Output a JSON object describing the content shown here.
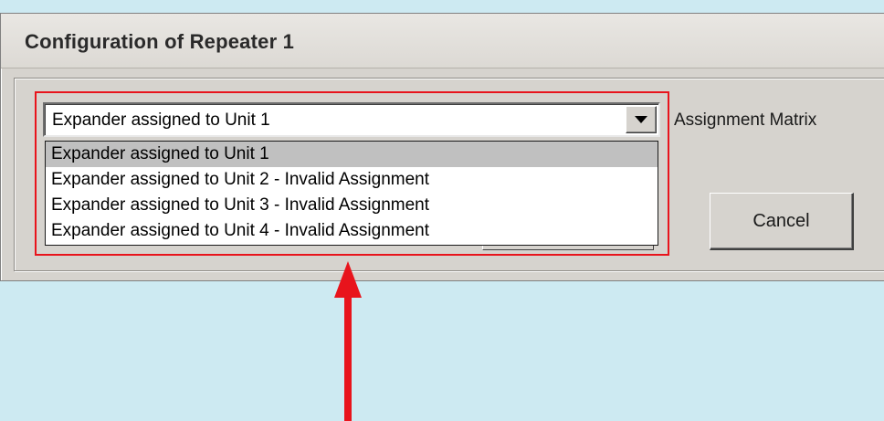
{
  "window": {
    "title": "Configuration of Repeater 1"
  },
  "combo": {
    "selected_value": "Expander assigned to Unit 1",
    "options": [
      "Expander assigned to Unit 1",
      "Expander assigned to Unit 2 - Invalid Assignment",
      "Expander assigned to Unit 3 - Invalid Assignment",
      "Expander assigned to Unit 4 - Invalid Assignment"
    ],
    "selected_index": 0
  },
  "labels": {
    "assignment_matrix": "Assignment Matrix"
  },
  "buttons": {
    "cancel": "Cancel"
  },
  "colors": {
    "background": "#cdeaf2",
    "dialog": "#d6d3ce",
    "highlight": "#e8141c",
    "selected_item": "#c0c0c0"
  },
  "icons": {
    "dropdown": "triangle-down-icon",
    "annotation": "arrow-up-icon"
  }
}
